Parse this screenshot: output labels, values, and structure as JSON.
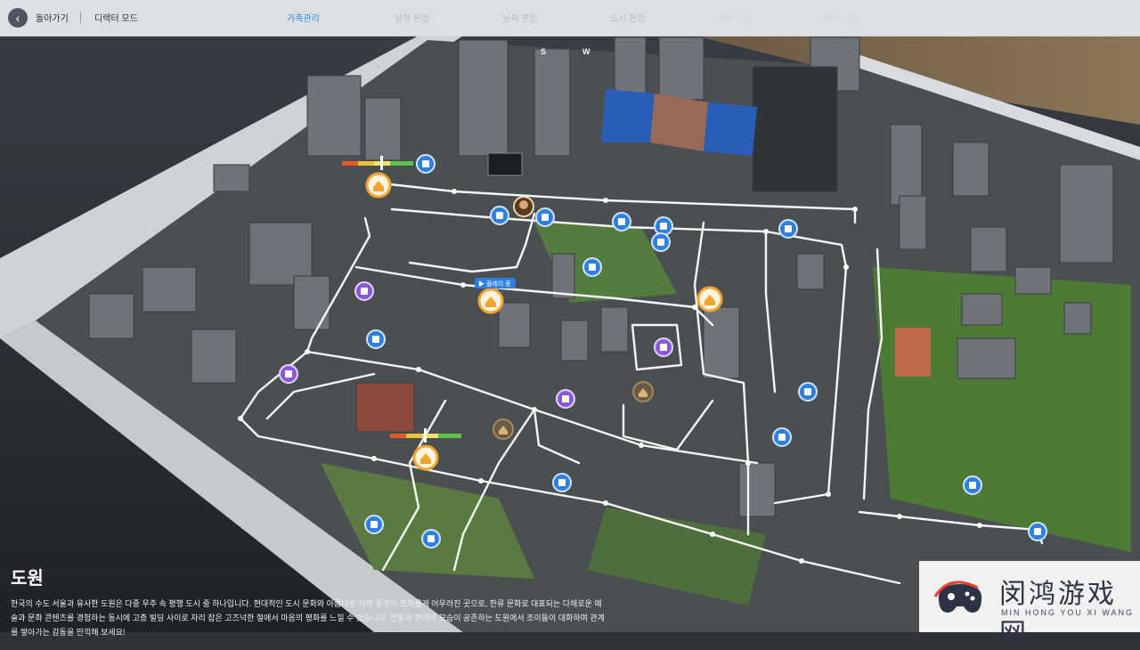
{
  "header": {
    "back_label": "돌아가기",
    "director_label": "디렉터 모드",
    "tabs": [
      {
        "label": "가족관리",
        "state": "active"
      },
      {
        "label": "일정 편집",
        "state": "normal"
      },
      {
        "label": "날씨 편집",
        "state": "normal"
      },
      {
        "label": "도시 편집",
        "state": "normal"
      },
      {
        "label": "배우 편집",
        "state": "disabled"
      },
      {
        "label": "배치 편집",
        "state": "disabled"
      }
    ]
  },
  "map": {
    "compass_s": "S",
    "compass_w": "W",
    "tooltip": "▶ 플레이 중"
  },
  "location": {
    "title": "도원",
    "description": "한국의 수도 서울과 유사한 도원은 다중 우주 속 평행 도시 중 하나입니다. 현대적인 도시 문화와 아름다운 자연 풍경이 조화롭게 어우러진 곳으로, 한류 문화로 대표되는 다채로운 예술과 문화 콘텐츠를 경험하는 동시에 고층 빌딩 사이로 자리 잡은 고즈넉한 절에서 마음의 평화를 느낄 수 있습니다. 전통과 현대의 모습이 공존하는 도원에서 조이들이 대화하며 관계를 쌓아가는 감동을 만끽해 보세요!"
  },
  "watermark": {
    "name": "闵鸿游戏网",
    "sub": "MIN HONG YOU XI WANG"
  },
  "colors": {
    "accent": "#2f86e6",
    "route": "#ffffff",
    "marker_blue": "#2f7fe0",
    "marker_purple": "#8a5ad6",
    "marker_home": "#f2a531"
  }
}
